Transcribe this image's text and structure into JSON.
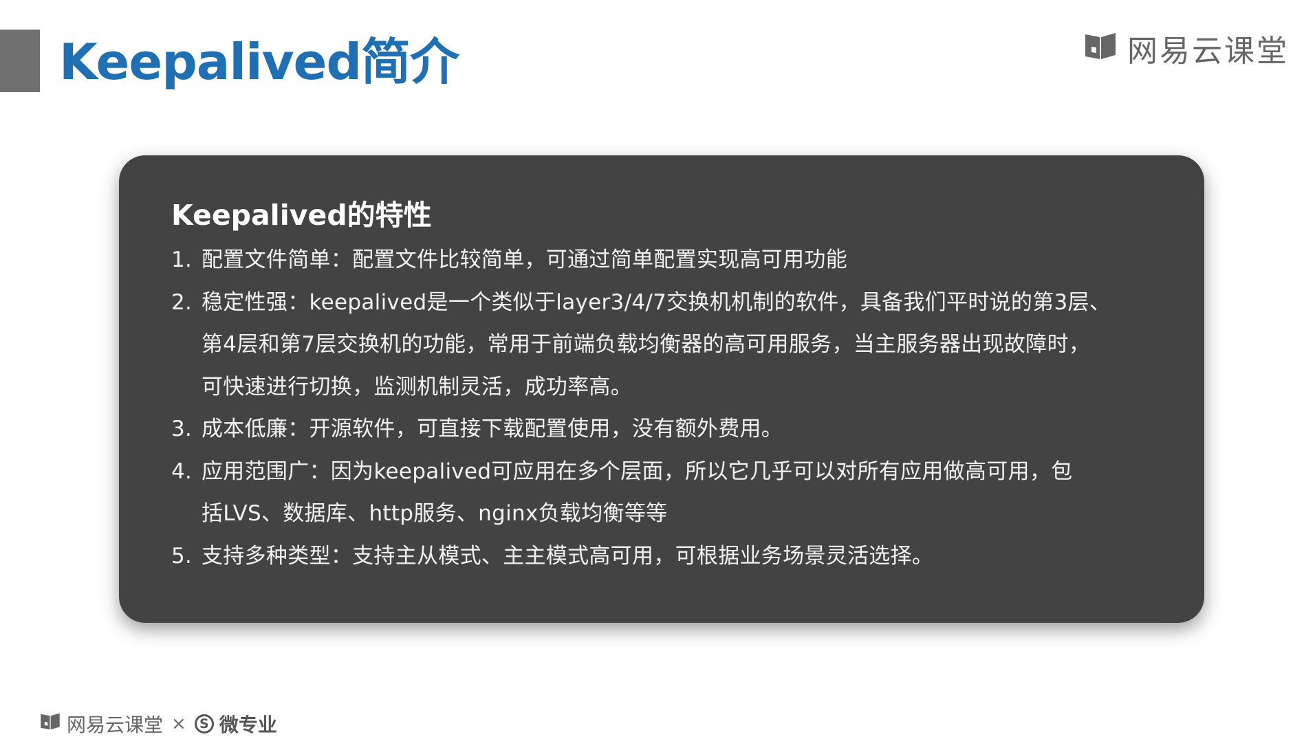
{
  "header": {
    "title": "Keepalived简介",
    "brand": "网易云课堂"
  },
  "card": {
    "heading": "Keepalived的特性",
    "items": [
      {
        "num": "1.",
        "lines": [
          "配置文件简单：配置文件比较简单，可通过简单配置实现高可用功能"
        ]
      },
      {
        "num": "2.",
        "lines": [
          "稳定性强：keepalived是一个类似于layer3/4/7交换机机制的软件，具备我们平时说的第3层、",
          "第4层和第7层交换机的功能，常用于前端负载均衡器的高可用服务，当主服务器出现故障时，",
          "可快速进行切换，监测机制灵活，成功率高。"
        ]
      },
      {
        "num": "3.",
        "lines": [
          "成本低廉：开源软件，可直接下载配置使用，没有额外费用。"
        ]
      },
      {
        "num": "4.",
        "lines": [
          "应用范围广：因为keepalived可应用在多个层面，所以它几乎可以对所有应用做高可用，包",
          "括LVS、数据库、http服务、nginx负载均衡等等"
        ]
      },
      {
        "num": "5.",
        "lines": [
          "支持多种类型：支持主从模式、主主模式高可用，可根据业务场景灵活选择。"
        ]
      }
    ]
  },
  "footer": {
    "brand": "网易云课堂",
    "separator": "×",
    "partner_mark": "S",
    "partner": "微专业"
  },
  "colors": {
    "title": "#1f6fb5",
    "card_background": "#434343",
    "title_bar": "#707070",
    "brand": "#666666"
  },
  "icons": {
    "brand_logo": "book-icon",
    "partner_logo": "circled-s-icon"
  }
}
